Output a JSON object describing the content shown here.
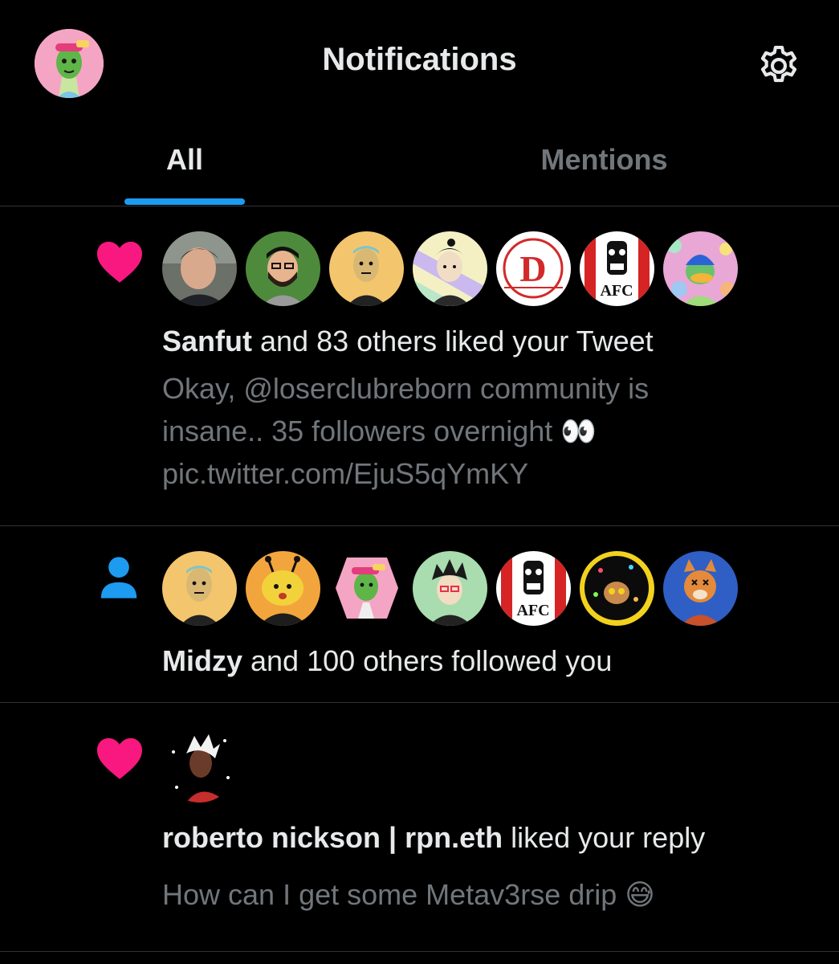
{
  "header": {
    "title": "Notifications",
    "profile_avatar_icon": "profile-avatar-icon",
    "settings_icon": "gear-icon"
  },
  "tabs": [
    {
      "label": "All",
      "active": true
    },
    {
      "label": "Mentions",
      "active": false
    }
  ],
  "colors": {
    "background": "#000000",
    "accent": "#1d9bf0",
    "like": "#f91880",
    "follow": "#1d9bf0",
    "secondary_text": "#71767b"
  },
  "notifications": [
    {
      "type_icon": "heart-icon",
      "actor": "Sanfut",
      "rest": " and 83 others liked your Tweet",
      "text": "Okay, @loserclubreborn community is insane.. 35 followers overnight 👀 pic.twitter.com/EjuS5qYmKY",
      "avatar_count": 7
    },
    {
      "type_icon": "person-icon",
      "actor": "Midzy",
      "rest": " and 100 others followed you",
      "avatar_count": 7
    },
    {
      "type_icon": "heart-icon",
      "actor": "roberto nickson | rpn.eth",
      "rest": " liked your reply",
      "text": "How can I get some Metav3rse drip 😅",
      "avatar_count": 1
    }
  ]
}
